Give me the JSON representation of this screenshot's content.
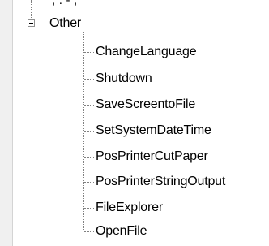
{
  "tree": {
    "truncated_above_label": ", . - ,",
    "parent": {
      "label": "Other",
      "expander_symbol": "minus",
      "expanded": true
    },
    "children": [
      {
        "label": "ChangeLanguage"
      },
      {
        "label": "Shutdown"
      },
      {
        "label": "SaveScreentoFile"
      },
      {
        "label": "SetSystemDateTime"
      },
      {
        "label": "PosPrinterCutPaper"
      },
      {
        "label": "PosPrinterStringOutput"
      },
      {
        "label": "FileExplorer"
      },
      {
        "label": "OpenFile"
      }
    ]
  },
  "colors": {
    "connector": "#808080",
    "expander_border": "#919191",
    "gutter": "#f0f0f0",
    "text": "#000000",
    "background": "#ffffff"
  }
}
